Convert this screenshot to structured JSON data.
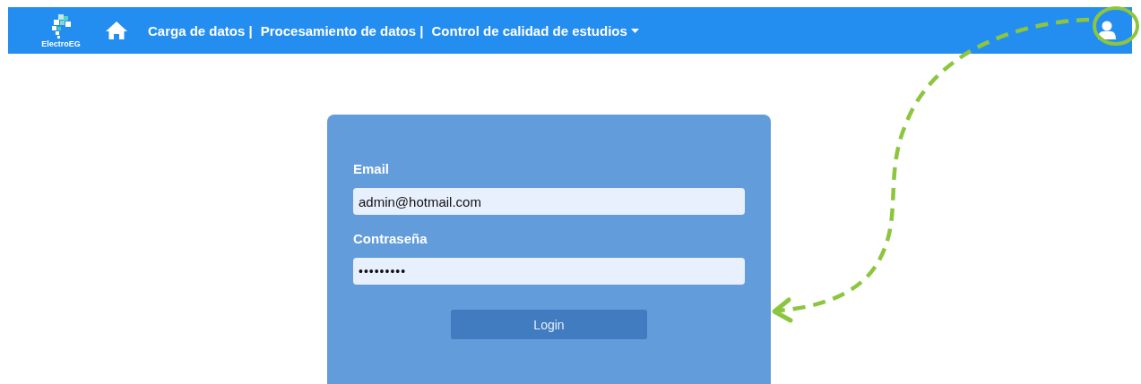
{
  "navbar": {
    "brand": "ElectroEG",
    "links": [
      {
        "label": "Carga de datos |",
        "dropdown": false
      },
      {
        "label": "Procesamiento de datos |",
        "dropdown": false
      },
      {
        "label": "Control de calidad de estudios",
        "dropdown": true
      }
    ]
  },
  "login_form": {
    "fields": [
      {
        "label": "Email",
        "value": "admin@hotmail.com"
      },
      {
        "label": "Contraseña",
        "value": "•••••••••"
      }
    ],
    "button": "Login"
  },
  "annotation": {
    "kind": "arrow"
  }
}
